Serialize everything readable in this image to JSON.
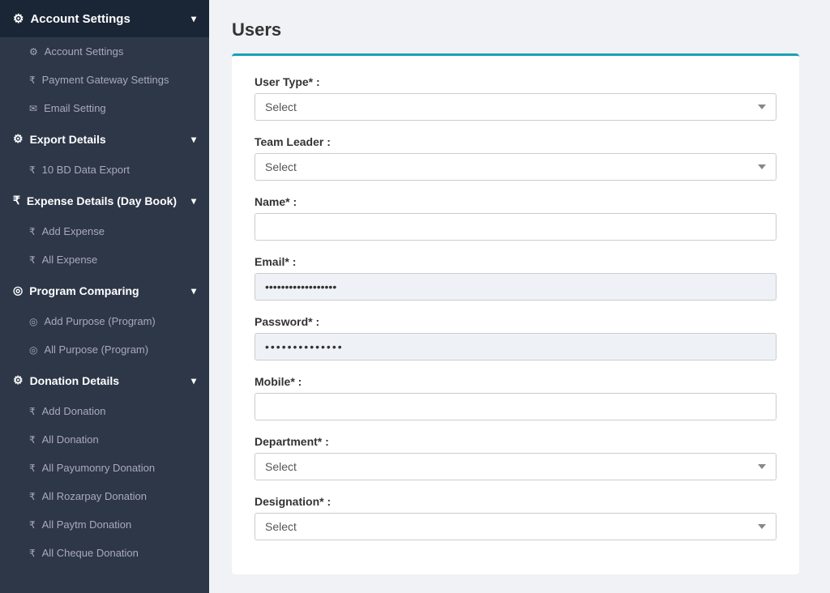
{
  "sidebar": {
    "account_settings_header": "Account Settings",
    "items_account": [
      {
        "label": "Account Settings",
        "icon": "⚙"
      },
      {
        "label": "Payment Gateway Settings",
        "icon": "₹"
      },
      {
        "label": "Email Setting",
        "icon": "✉"
      }
    ],
    "export_details_header": "Export Details",
    "items_export": [
      {
        "label": "10 BD Data Export",
        "icon": "₹"
      }
    ],
    "expense_details_header": "Expense Details (Day Book)",
    "items_expense": [
      {
        "label": "Add Expense",
        "icon": "₹"
      },
      {
        "label": "All Expense",
        "icon": "₹"
      }
    ],
    "program_comparing_header": "Program Comparing",
    "items_program": [
      {
        "label": "Add Purpose (Program)",
        "icon": "◎"
      },
      {
        "label": "All Purpose (Program)",
        "icon": "◎"
      }
    ],
    "donation_details_header": "Donation Details",
    "items_donation": [
      {
        "label": "Add Donation",
        "icon": "₹"
      },
      {
        "label": "All Donation",
        "icon": "₹"
      },
      {
        "label": "All Payumonry Donation",
        "icon": "₹"
      },
      {
        "label": "All Rozarpay Donation",
        "icon": "₹"
      },
      {
        "label": "All Paytm Donation",
        "icon": "₹"
      },
      {
        "label": "All Cheque Donation",
        "icon": "₹"
      }
    ]
  },
  "main": {
    "page_title": "Users",
    "form": {
      "user_type_label": "User Type* :",
      "user_type_placeholder": "Select",
      "team_leader_label": "Team Leader :",
      "team_leader_placeholder": "Select",
      "name_label": "Name* :",
      "name_value": "",
      "email_label": "Email* :",
      "email_value": "••••••••••••••••••",
      "password_label": "Password* :",
      "password_value": "••••••••••••••",
      "mobile_label": "Mobile* :",
      "mobile_value": "",
      "department_label": "Department* :",
      "department_placeholder": "Select",
      "designation_label": "Designation* :",
      "designation_placeholder": "Select"
    }
  }
}
